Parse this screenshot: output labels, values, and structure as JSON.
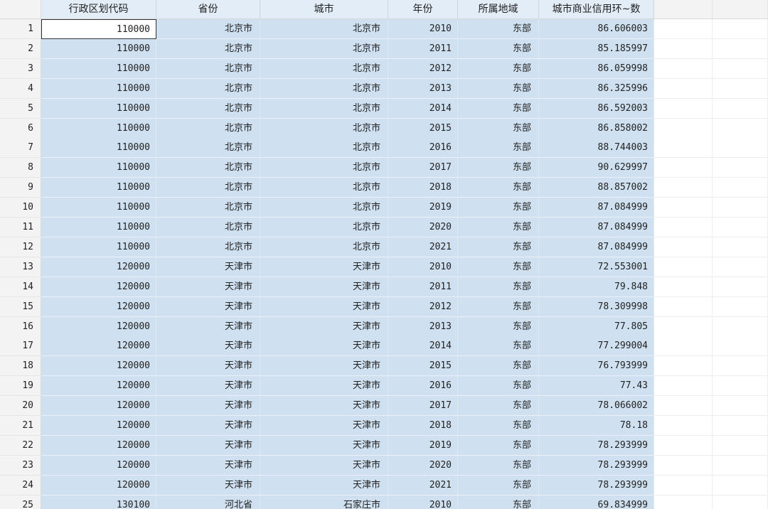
{
  "table": {
    "columns": [
      "行政区划代码",
      "省份",
      "城市",
      "年份",
      "所属地域",
      "城市商业信用环~数"
    ],
    "rows": [
      {
        "n": "1",
        "code": "110000",
        "province": "北京市",
        "city": "北京市",
        "year": "2010",
        "region": "东部",
        "value": "86.606003"
      },
      {
        "n": "2",
        "code": "110000",
        "province": "北京市",
        "city": "北京市",
        "year": "2011",
        "region": "东部",
        "value": "85.185997"
      },
      {
        "n": "3",
        "code": "110000",
        "province": "北京市",
        "city": "北京市",
        "year": "2012",
        "region": "东部",
        "value": "86.059998"
      },
      {
        "n": "4",
        "code": "110000",
        "province": "北京市",
        "city": "北京市",
        "year": "2013",
        "region": "东部",
        "value": "86.325996"
      },
      {
        "n": "5",
        "code": "110000",
        "province": "北京市",
        "city": "北京市",
        "year": "2014",
        "region": "东部",
        "value": "86.592003"
      },
      {
        "n": "6",
        "code": "110000",
        "province": "北京市",
        "city": "北京市",
        "year": "2015",
        "region": "东部",
        "value": "86.858002"
      },
      {
        "n": "7",
        "code": "110000",
        "province": "北京市",
        "city": "北京市",
        "year": "2016",
        "region": "东部",
        "value": "88.744003"
      },
      {
        "n": "8",
        "code": "110000",
        "province": "北京市",
        "city": "北京市",
        "year": "2017",
        "region": "东部",
        "value": "90.629997"
      },
      {
        "n": "9",
        "code": "110000",
        "province": "北京市",
        "city": "北京市",
        "year": "2018",
        "region": "东部",
        "value": "88.857002"
      },
      {
        "n": "10",
        "code": "110000",
        "province": "北京市",
        "city": "北京市",
        "year": "2019",
        "region": "东部",
        "value": "87.084999"
      },
      {
        "n": "11",
        "code": "110000",
        "province": "北京市",
        "city": "北京市",
        "year": "2020",
        "region": "东部",
        "value": "87.084999"
      },
      {
        "n": "12",
        "code": "110000",
        "province": "北京市",
        "city": "北京市",
        "year": "2021",
        "region": "东部",
        "value": "87.084999"
      },
      {
        "n": "13",
        "code": "120000",
        "province": "天津市",
        "city": "天津市",
        "year": "2010",
        "region": "东部",
        "value": "72.553001"
      },
      {
        "n": "14",
        "code": "120000",
        "province": "天津市",
        "city": "天津市",
        "year": "2011",
        "region": "东部",
        "value": "79.848"
      },
      {
        "n": "15",
        "code": "120000",
        "province": "天津市",
        "city": "天津市",
        "year": "2012",
        "region": "东部",
        "value": "78.309998"
      },
      {
        "n": "16",
        "code": "120000",
        "province": "天津市",
        "city": "天津市",
        "year": "2013",
        "region": "东部",
        "value": "77.805"
      },
      {
        "n": "17",
        "code": "120000",
        "province": "天津市",
        "city": "天津市",
        "year": "2014",
        "region": "东部",
        "value": "77.299004"
      },
      {
        "n": "18",
        "code": "120000",
        "province": "天津市",
        "city": "天津市",
        "year": "2015",
        "region": "东部",
        "value": "76.793999"
      },
      {
        "n": "19",
        "code": "120000",
        "province": "天津市",
        "city": "天津市",
        "year": "2016",
        "region": "东部",
        "value": "77.43"
      },
      {
        "n": "20",
        "code": "120000",
        "province": "天津市",
        "city": "天津市",
        "year": "2017",
        "region": "东部",
        "value": "78.066002"
      },
      {
        "n": "21",
        "code": "120000",
        "province": "天津市",
        "city": "天津市",
        "year": "2018",
        "region": "东部",
        "value": "78.18"
      },
      {
        "n": "22",
        "code": "120000",
        "province": "天津市",
        "city": "天津市",
        "year": "2019",
        "region": "东部",
        "value": "78.293999"
      },
      {
        "n": "23",
        "code": "120000",
        "province": "天津市",
        "city": "天津市",
        "year": "2020",
        "region": "东部",
        "value": "78.293999"
      },
      {
        "n": "24",
        "code": "120000",
        "province": "天津市",
        "city": "天津市",
        "year": "2021",
        "region": "东部",
        "value": "78.293999"
      },
      {
        "n": "25",
        "code": "130100",
        "province": "河北省",
        "city": "石家庄市",
        "year": "2010",
        "region": "东部",
        "value": "69.834999"
      }
    ]
  },
  "colors": {
    "selection": "#cfe0f0",
    "header": "#e2edf7",
    "row_header": "#f3f3f3"
  }
}
